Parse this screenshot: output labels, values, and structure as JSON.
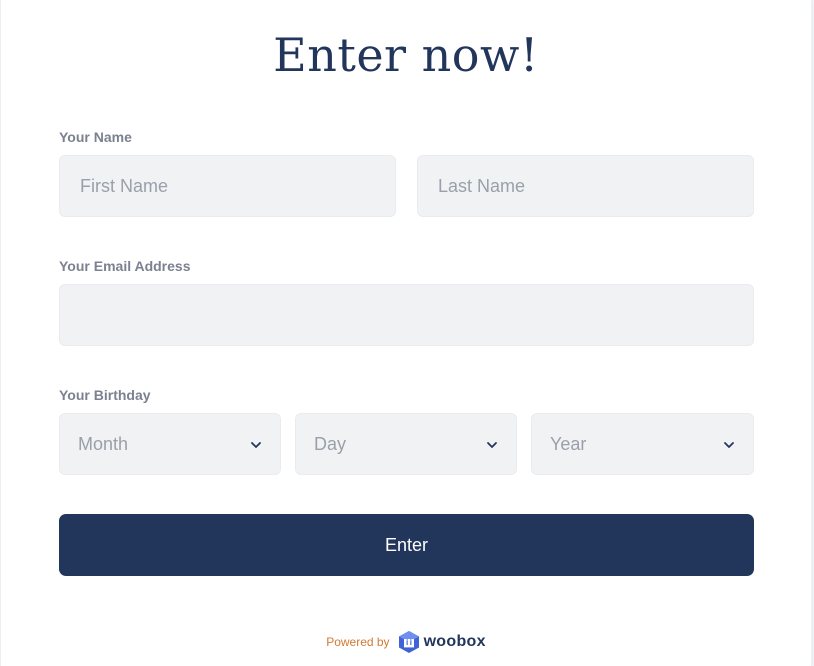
{
  "form": {
    "title": "Enter now!",
    "name_label": "Your Name",
    "first_name_placeholder": "First Name",
    "last_name_placeholder": "Last Name",
    "email_label": "Your Email Address",
    "email_value": "",
    "birthday_label": "Your Birthday",
    "month_placeholder": "Month",
    "day_placeholder": "Day",
    "year_placeholder": "Year",
    "submit_label": "Enter"
  },
  "footer": {
    "powered_by": "Powered by",
    "brand": "woobox"
  },
  "icons": {
    "dropdown": "chevron-down-icon",
    "brand_logo": "woobox-logo-icon"
  },
  "colors": {
    "primary": "#22365b",
    "field_bg": "#f1f2f4",
    "label": "#7b8190",
    "placeholder": "#9aa0aa",
    "powered_text": "#d07a34"
  }
}
